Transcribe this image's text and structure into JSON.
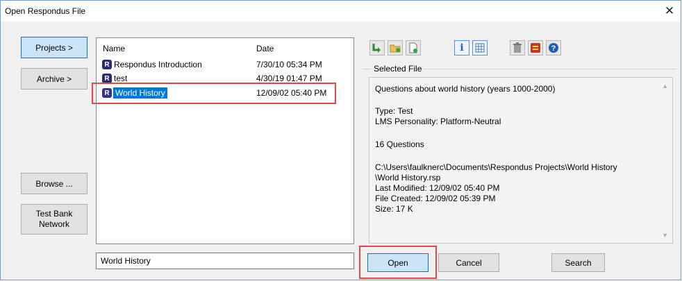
{
  "window": {
    "title": "Open Respondus File",
    "close_glyph": "✕"
  },
  "sidebar": {
    "projects_label": "Projects >",
    "archive_label": "Archive >",
    "browse_label": "Browse ...",
    "testbank_line1": "Test Bank",
    "testbank_line2": "Network"
  },
  "file_list": {
    "columns": {
      "name": "Name",
      "date": "Date"
    },
    "rows": [
      {
        "icon": "R",
        "name": "Respondus Introduction",
        "date": "7/30/10  05:34 PM"
      },
      {
        "icon": "R",
        "name": "test",
        "date": "4/30/19  01:47 PM"
      },
      {
        "icon": "R",
        "name": "World History",
        "date": "12/09/02  05:40 PM",
        "selected": true
      }
    ]
  },
  "filename_input": {
    "value": "World History"
  },
  "toolbar": {
    "icons": [
      "import-icon",
      "new-folder-icon",
      "new-file-icon",
      "info-icon",
      "grid-view-icon",
      "trash-icon",
      "archive-box-icon",
      "help-icon"
    ]
  },
  "selected_file": {
    "label": "Selected File",
    "description": "Questions about world history (years 1000-2000)",
    "type": "Type: Test",
    "lms": "LMS Personality: Platform-Neutral",
    "questions": "16 Questions",
    "path_line1": "C:\\Users\\faulknerc\\Documents\\Respondus Projects\\World History",
    "path_line2": "\\World History.rsp",
    "last_modified": "Last Modified: 12/09/02  05:40 PM",
    "file_created": "File Created: 12/09/02  05:39 PM",
    "size": "Size: 17 K"
  },
  "buttons": {
    "open": "Open",
    "cancel": "Cancel",
    "search": "Search"
  },
  "colors": {
    "highlight": "#e0484a",
    "selection": "#0078d7",
    "title_border": "#6d9fd6"
  }
}
